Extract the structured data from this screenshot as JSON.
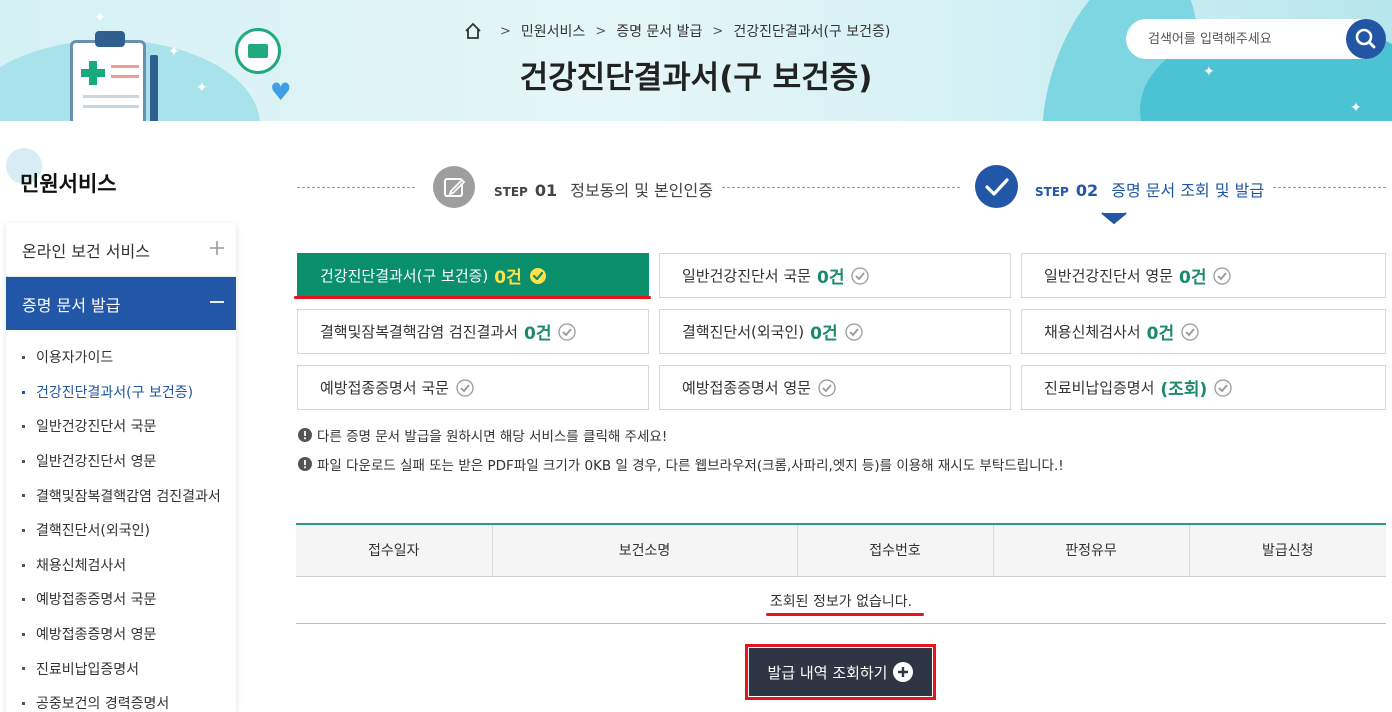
{
  "header": {
    "breadcrumb": [
      "민원서비스",
      "증명 문서 발급",
      "건강진단결과서(구 보건증)"
    ],
    "title": "건강진단결과서(구 보건증)",
    "search_placeholder": "검색어를 입력해주세요"
  },
  "sidebar": {
    "title": "민원서비스",
    "categories": [
      {
        "label": "온라인 보건 서비스",
        "state": "collapsed"
      },
      {
        "label": "증명 문서 발급",
        "state": "expanded"
      }
    ],
    "sub_items": [
      "이용자가이드",
      "건강진단결과서(구 보건증)",
      "일반건강진단서 국문",
      "일반건강진단서 영문",
      "결핵및잠복결핵감염 검진결과서",
      "결핵진단서(외국인)",
      "채용신체검사서",
      "예방접종증명서 국문",
      "예방접종증명서 영문",
      "진료비납입증명서",
      "공중보건의 경력증명서"
    ],
    "current_item": "건강진단결과서(구 보건증)"
  },
  "steps": [
    {
      "prefix": "STEP",
      "number": "01",
      "label": "정보동의 및 본인인증",
      "state": "done"
    },
    {
      "prefix": "STEP",
      "number": "02",
      "label": "증명 문서 조회 및 발급",
      "state": "current"
    }
  ],
  "documents": [
    {
      "label": "건강진단결과서(구 보건증)",
      "count": "0건",
      "active": true
    },
    {
      "label": "일반건강진단서 국문",
      "count": "0건"
    },
    {
      "label": "일반건강진단서 영문",
      "count": "0건"
    },
    {
      "label": "결핵및잠복결핵감염 검진결과서",
      "count": "0건"
    },
    {
      "label": "결핵진단서(외국인)",
      "count": "0건"
    },
    {
      "label": "채용신체검사서",
      "count": "0건"
    },
    {
      "label": "예방접종증명서 국문",
      "count": ""
    },
    {
      "label": "예방접종증명서 영문",
      "count": ""
    },
    {
      "label": "진료비납입증명서",
      "count": "(조회)"
    }
  ],
  "notices": [
    "다른 증명 문서 발급을 원하시면 해당 서비스를 클릭해 주세요!",
    "파일 다운로드 실패 또는 받은 PDF파일 크기가 0KB 일 경우, 다른 웹브라우저(크롬,사파리,엣지 등)를 이용해 재시도 부탁드립니다.!"
  ],
  "table": {
    "columns": [
      "접수일자",
      "보건소명",
      "접수번호",
      "판정유무",
      "발급신청"
    ],
    "empty_message": "조회된 정보가 없습니다."
  },
  "query_button": {
    "label": "발급 내역 조회하기"
  },
  "colors": {
    "primary_blue": "#2157a6",
    "active_green": "#0a8f6c",
    "count_green": "#1b8a6b",
    "highlight_red": "#e5141d",
    "button_dark": "#2e3545"
  }
}
